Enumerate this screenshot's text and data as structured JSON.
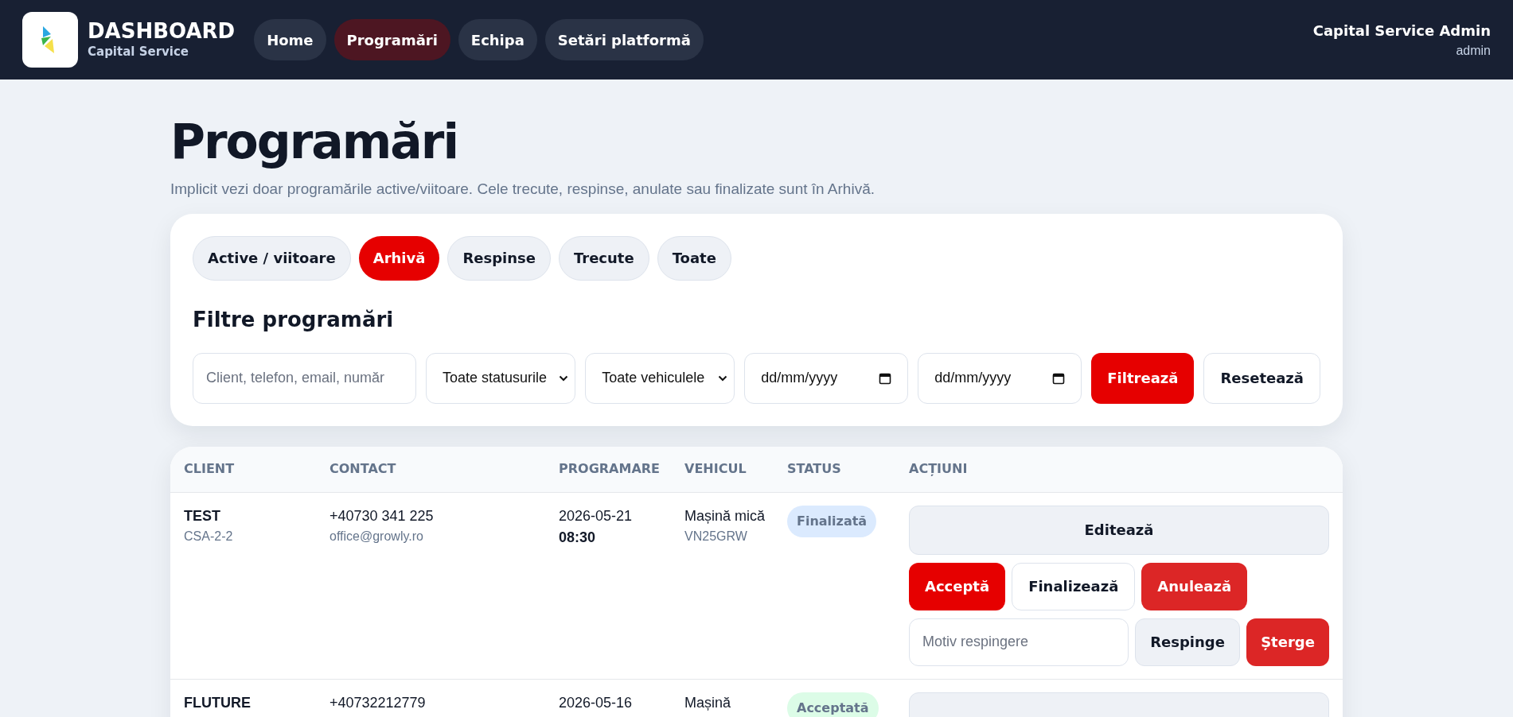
{
  "brand": {
    "title": "DASHBOARD",
    "subtitle": "Capital Service"
  },
  "nav": [
    {
      "label": "Home",
      "selected": false
    },
    {
      "label": "Programări",
      "selected": true
    },
    {
      "label": "Echipa",
      "selected": false
    },
    {
      "label": "Setări platformă",
      "selected": false
    }
  ],
  "user": {
    "name": "Capital Service Admin",
    "role": "admin"
  },
  "page": {
    "title": "Programări",
    "subtitle": "Implicit vezi doar programările active/viitoare. Cele trecute, respinse, anulate sau finalizate sunt în Arhivă."
  },
  "tabs": [
    {
      "label": "Active / viitoare",
      "selected": false
    },
    {
      "label": "Arhivă",
      "selected": true
    },
    {
      "label": "Respinse",
      "selected": false
    },
    {
      "label": "Trecute",
      "selected": false
    },
    {
      "label": "Toate",
      "selected": false
    }
  ],
  "filters": {
    "title": "Filtre programări",
    "search_placeholder": "Client, telefon, email, număr",
    "status_select": "Toate statusurile",
    "vehicle_select": "Toate vehiculele",
    "date_from": "dd/mm/yyyy",
    "date_to": "dd/mm/yyyy",
    "filter_button": "Filtrează",
    "reset_button": "Resetează"
  },
  "table": {
    "columns": [
      "CLIENT",
      "CONTACT",
      "PROGRAMARE",
      "VEHICUL",
      "STATUS",
      "ACȚIUNI"
    ],
    "rows": [
      {
        "client": "TEST",
        "code": "CSA-2-2",
        "phone": "+40730 341 225",
        "email": "office@growly.ro",
        "date": "2026-05-21",
        "time": "08:30",
        "vehicle": "Mașină mică",
        "plate": "VN25GRW",
        "status": "Finalizată",
        "color": "#dbeafe",
        "actions": {
          "edit": "Editează",
          "accept": "Acceptă",
          "finalize": "Finalizează",
          "cancel": "Anulează",
          "reason_placeholder": "Motiv respingere",
          "reject": "Respinge",
          "delete": "Șterge"
        }
      },
      {
        "client": "FLUTURE",
        "phone": "+40732212779",
        "date": "2026-05-16",
        "vehicle": "Mașină",
        "status": "Acceptată",
        "color": "#dcfce7"
      }
    ]
  }
}
